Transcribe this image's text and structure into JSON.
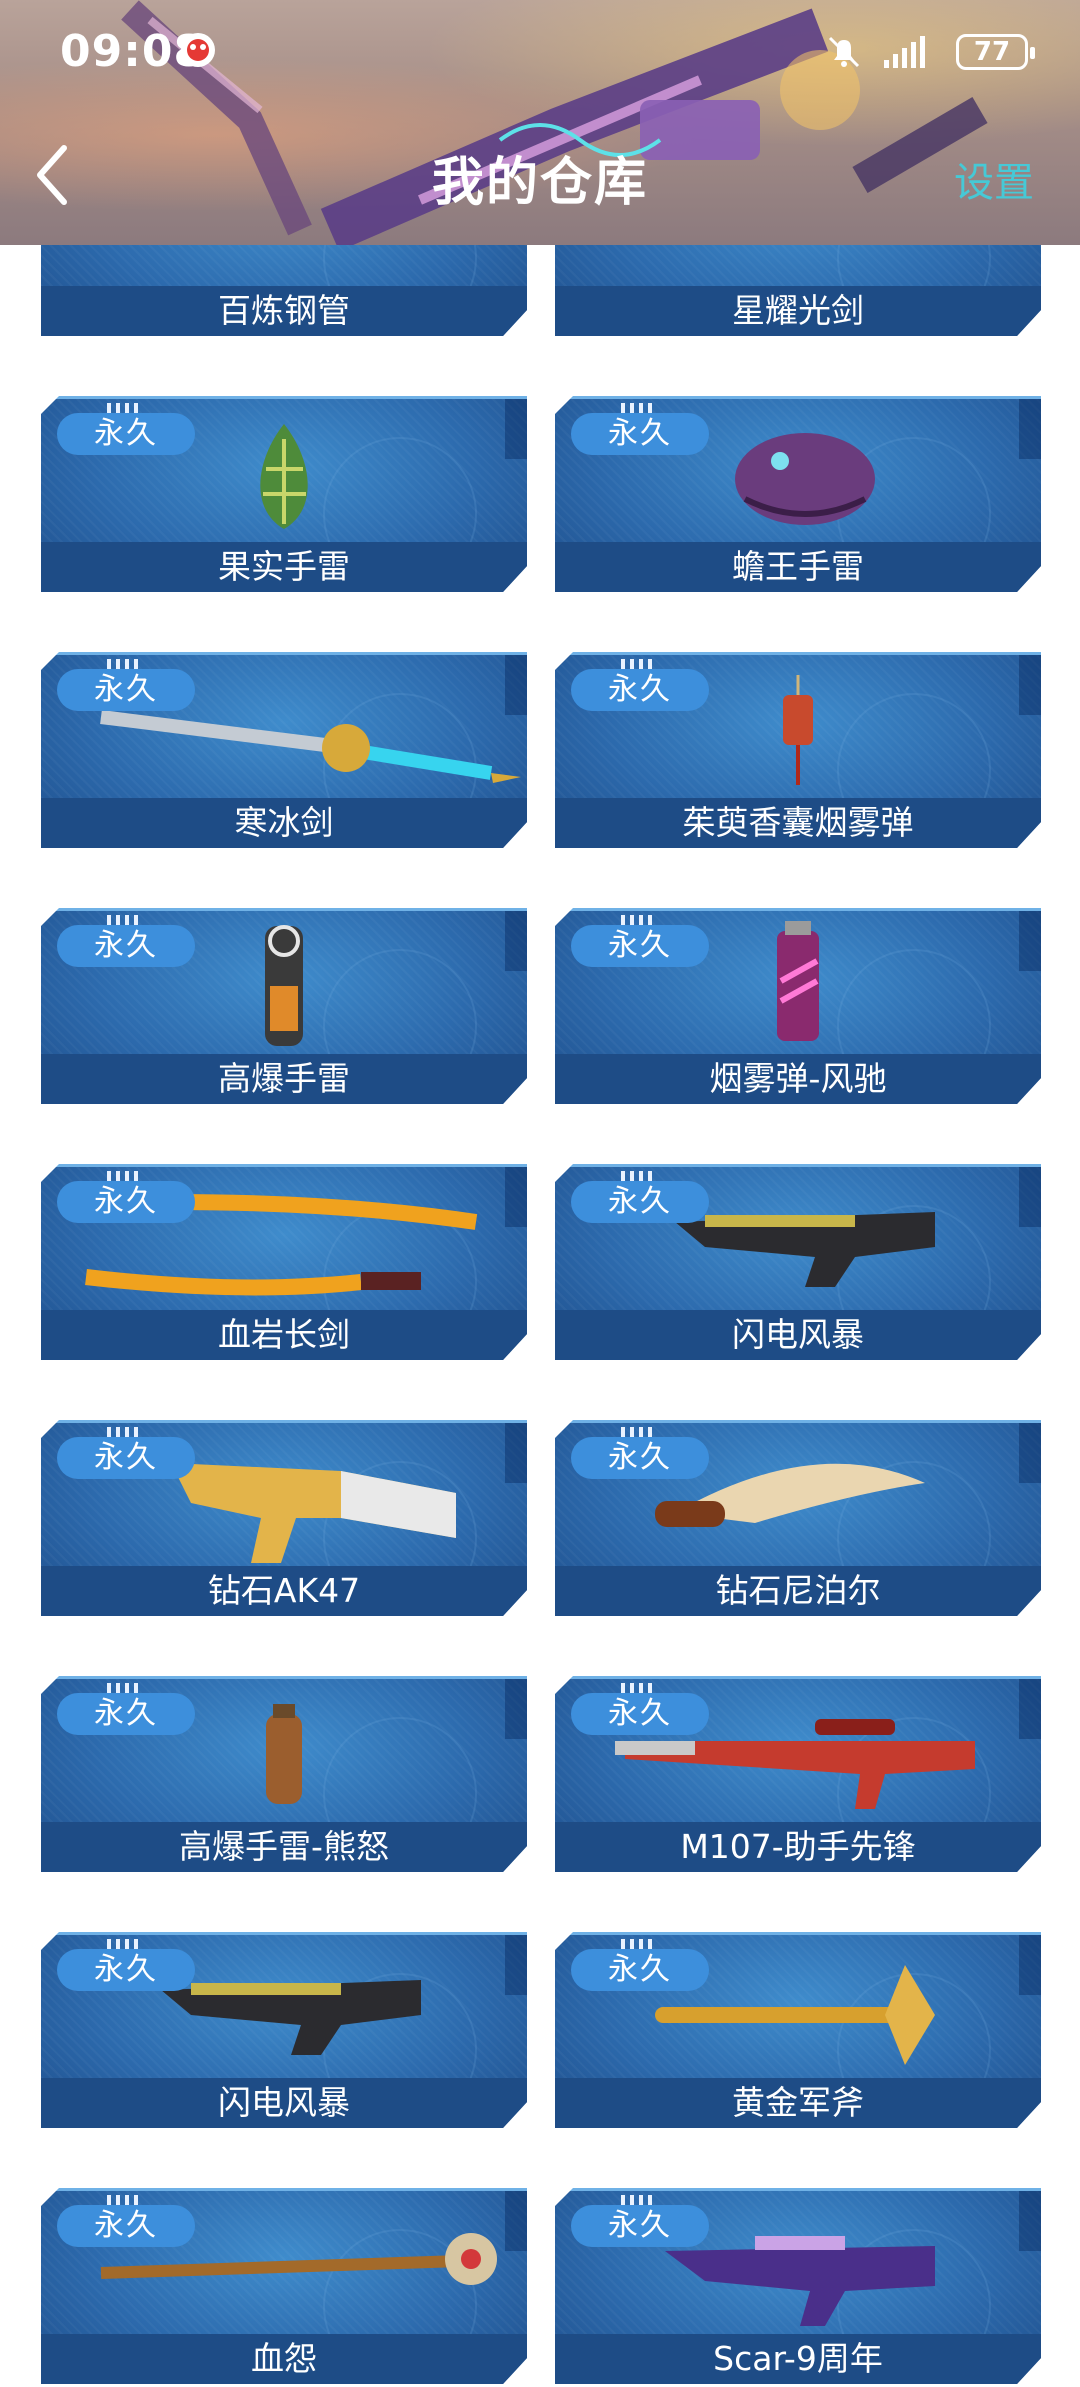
{
  "status": {
    "time": "09:08",
    "battery": "77"
  },
  "header": {
    "title": "我的仓库",
    "settings_label": "设置"
  },
  "items": [
    {
      "name": "百炼钢管",
      "badge": "",
      "icon": "steel-pipe-icon"
    },
    {
      "name": "星耀光剑",
      "badge": "",
      "icon": "light-sword-icon"
    },
    {
      "name": "果实手雷",
      "badge": "永久",
      "icon": "fruit-grenade-icon"
    },
    {
      "name": "蟾王手雷",
      "badge": "永久",
      "icon": "toad-grenade-icon"
    },
    {
      "name": "寒冰剑",
      "badge": "永久",
      "icon": "ice-sword-icon"
    },
    {
      "name": "茱萸香囊烟雾弹",
      "badge": "永久",
      "icon": "sachet-smoke-icon"
    },
    {
      "name": "高爆手雷",
      "badge": "永久",
      "icon": "he-grenade-icon"
    },
    {
      "name": "烟雾弹-风驰",
      "badge": "永久",
      "icon": "smoke-grenade-icon"
    },
    {
      "name": "血岩长剑",
      "badge": "永久",
      "icon": "lava-sword-icon"
    },
    {
      "name": "闪电风暴",
      "badge": "永久",
      "icon": "lightning-rifle-icon"
    },
    {
      "name": "钻石AK47",
      "badge": "永久",
      "icon": "gold-ak47-icon"
    },
    {
      "name": "钻石尼泊尔",
      "badge": "永久",
      "icon": "kukri-knife-icon"
    },
    {
      "name": "高爆手雷-熊怒",
      "badge": "永久",
      "icon": "bear-grenade-icon"
    },
    {
      "name": "M107-助手先锋",
      "badge": "永久",
      "icon": "sniper-rifle-icon"
    },
    {
      "name": "闪电风暴",
      "badge": "永久",
      "icon": "lightning-rifle-icon"
    },
    {
      "name": "黄金军斧",
      "badge": "永久",
      "icon": "gold-axe-icon"
    },
    {
      "name": "血怨",
      "badge": "永久",
      "icon": "blood-staff-icon"
    },
    {
      "name": "Scar-9周年",
      "badge": "永久",
      "icon": "scar-rifle-icon"
    }
  ]
}
